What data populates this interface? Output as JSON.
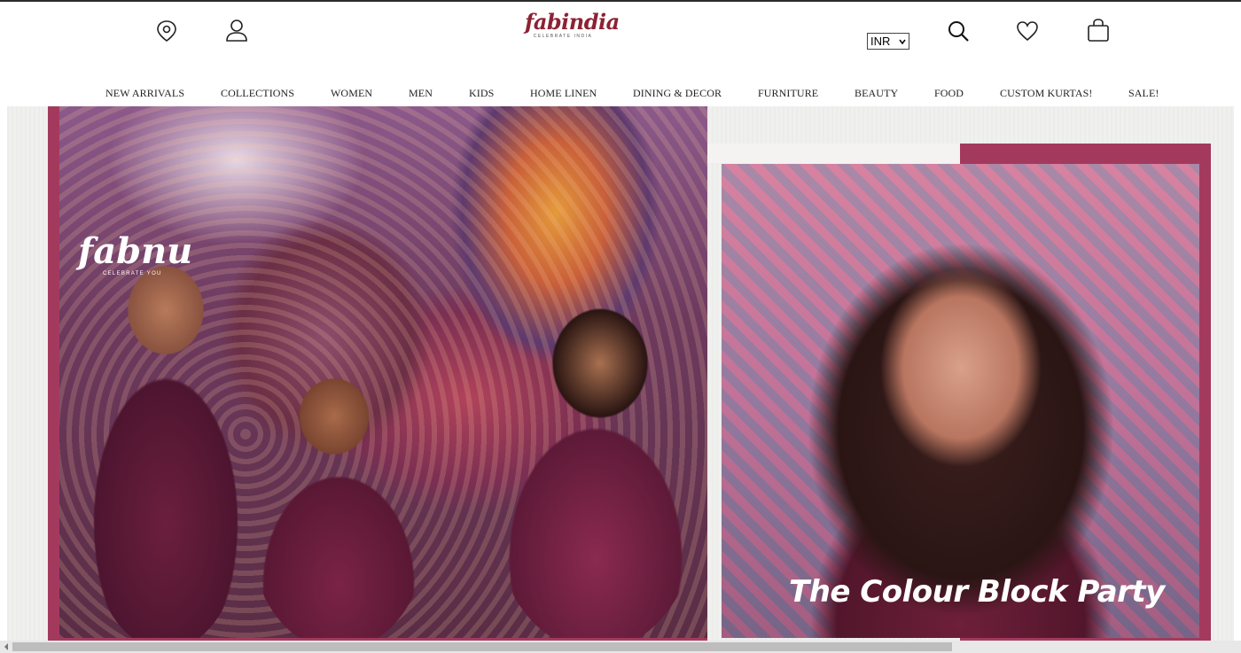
{
  "header": {
    "logo": {
      "name": "fabindia",
      "tagline": "CELEBRATE INDIA"
    },
    "currency": {
      "selected": "INR"
    },
    "icons": [
      "location-pin-icon",
      "user-icon",
      "search-icon",
      "heart-icon",
      "shopping-bag-icon"
    ]
  },
  "nav": {
    "items": [
      {
        "label": "NEW ARRIVALS"
      },
      {
        "label": "COLLECTIONS"
      },
      {
        "label": "WOMEN"
      },
      {
        "label": "MEN"
      },
      {
        "label": "KIDS"
      },
      {
        "label": "HOME LINEN"
      },
      {
        "label": "DINING & DECOR"
      },
      {
        "label": "FURNITURE"
      },
      {
        "label": "BEAUTY"
      },
      {
        "label": "FOOD"
      },
      {
        "label": "CUSTOM KURTAS!"
      },
      {
        "label": "SALE!"
      }
    ]
  },
  "hero": {
    "brand_mark": "fabnu",
    "brand_tagline": "CELEBRATE YOU",
    "headline": "The Colour Block Party"
  },
  "colors": {
    "brand": "#8c2233",
    "accent_panel": "#a33a5e"
  }
}
